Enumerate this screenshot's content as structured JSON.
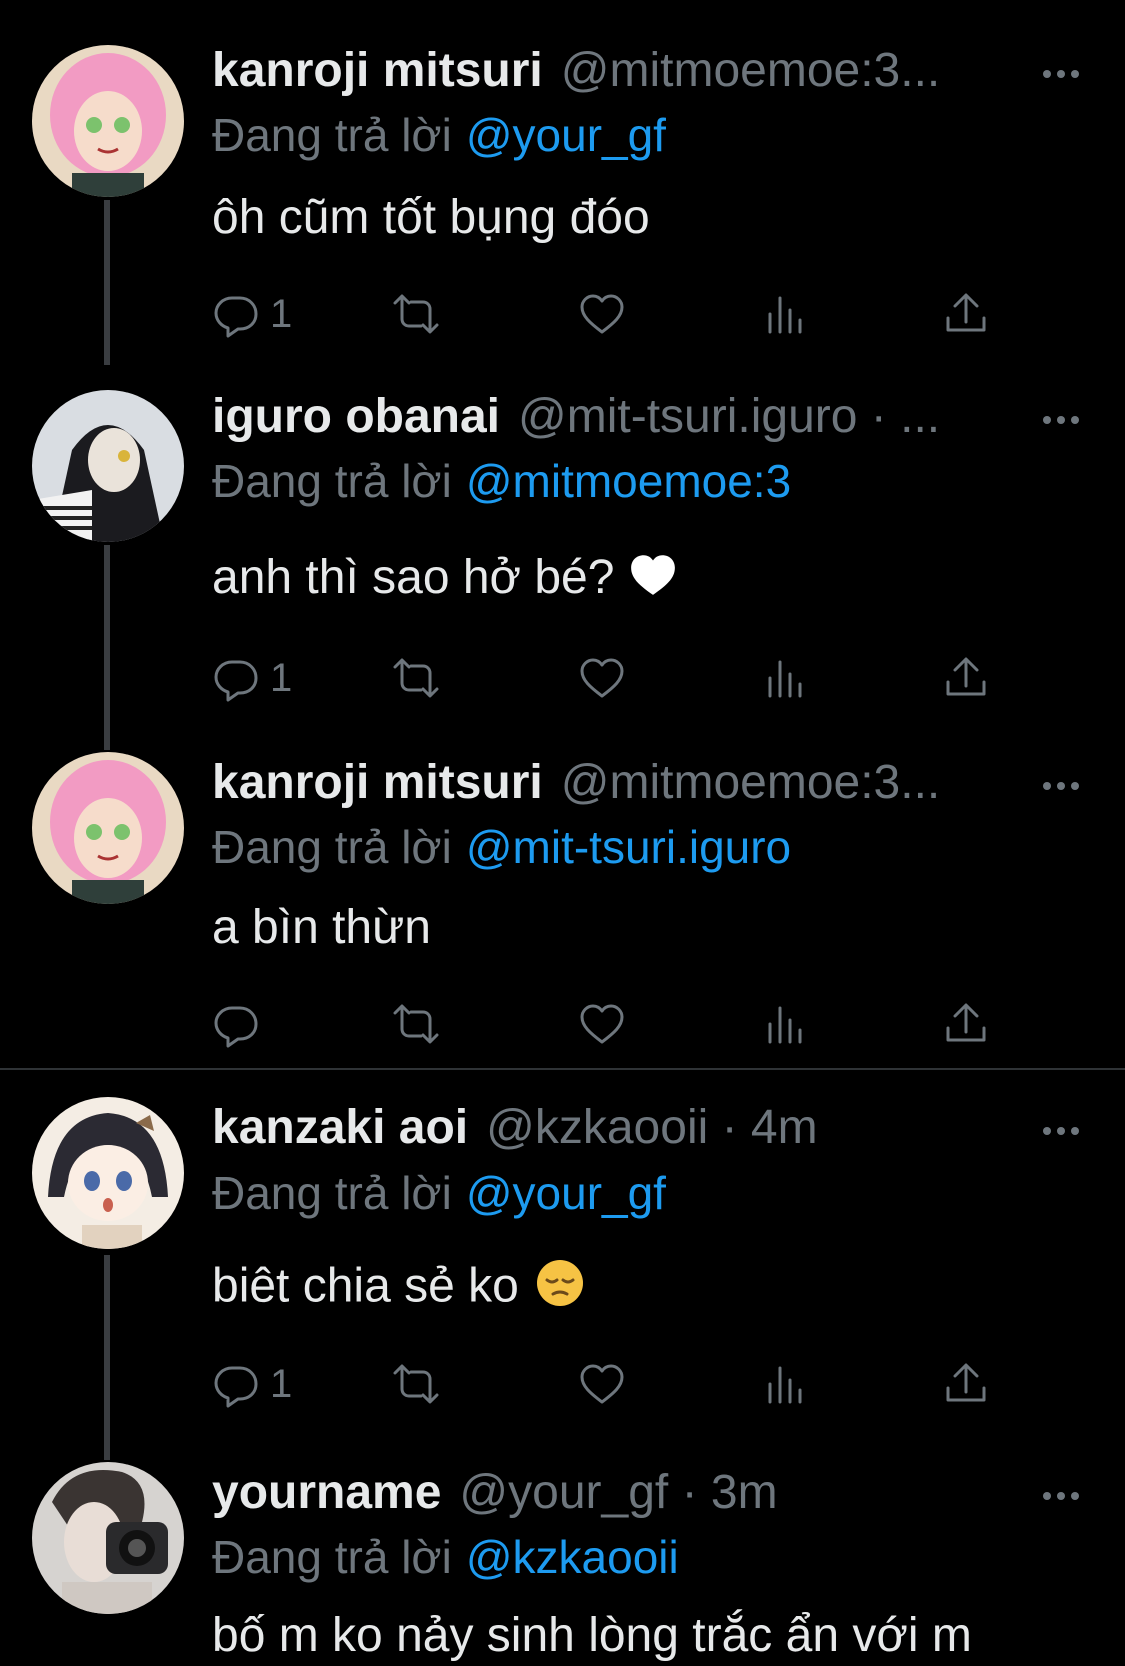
{
  "replying_to_label": "Đang trả lời",
  "tweets": [
    {
      "name": "kanroji mitsuri",
      "handle": "@mitmoemoe:3...",
      "reply_to": "@your_gf",
      "text": "ôh cũm tốt bụng đóo",
      "reply_count": "1"
    },
    {
      "name": "iguro obanai",
      "handle": "@mit-tsuri.iguro · ...",
      "reply_to": "@mitmoemoe:3",
      "text": "anh thì sao hở bé?",
      "reply_count": "1"
    },
    {
      "name": "kanroji mitsuri",
      "handle": "@mitmoemoe:3...",
      "reply_to": "@mit-tsuri.iguro",
      "text": "a bìn thừn",
      "reply_count": ""
    },
    {
      "name": "kanzaki aoi",
      "handle": "@kzkaooii · 4m",
      "reply_to": "@your_gf",
      "text": "biêt chia sẻ ko",
      "reply_count": "1"
    },
    {
      "name": "yourname",
      "handle": "@your_gf · 3m",
      "reply_to": "@kzkaooii",
      "text": "bố m ko nảy sinh lòng trắc ẩn với m",
      "reply_count": ""
    }
  ],
  "colors": {
    "background": "#000000",
    "text": "#e7e9ea",
    "secondary": "#6e767d",
    "accent": "#1d9bf0"
  }
}
